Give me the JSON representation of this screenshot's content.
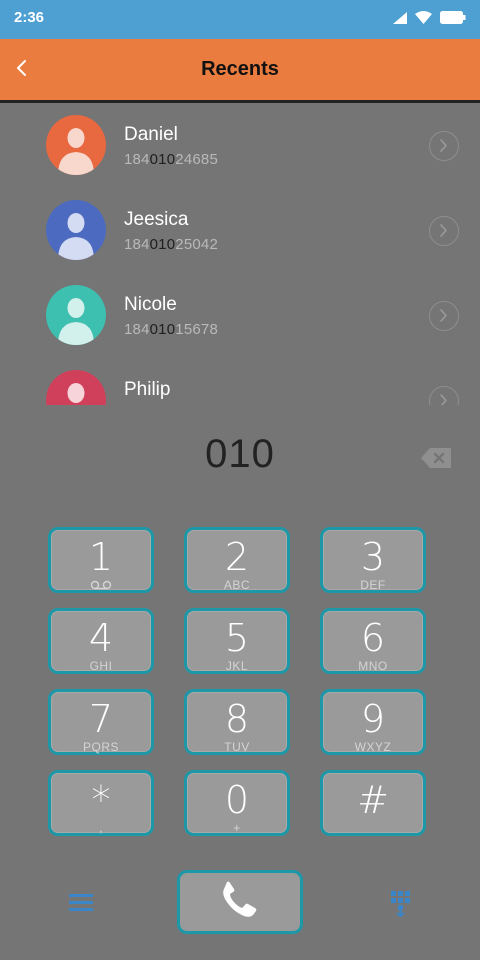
{
  "status_bar": {
    "time": "2:36"
  },
  "header": {
    "title": "Recents"
  },
  "contacts": [
    {
      "name": "Daniel",
      "number_prefix": "184",
      "number_match": "010",
      "number_suffix": "24685",
      "avatar_color": "#e8683f",
      "avatar_light": "#f8d7cc"
    },
    {
      "name": "Jeesica",
      "number_prefix": "184",
      "number_match": "010",
      "number_suffix": "25042",
      "avatar_color": "#4c6bc0",
      "avatar_light": "#d4dcf3"
    },
    {
      "name": "Nicole",
      "number_prefix": "184",
      "number_match": "010",
      "number_suffix": "15678",
      "avatar_color": "#3ec0b0",
      "avatar_light": "#d2f0ec"
    },
    {
      "name": "Philip",
      "number_prefix": "",
      "number_match": "",
      "number_suffix": "",
      "avatar_color": "#d0405a",
      "avatar_light": "#f6d4da"
    }
  ],
  "dialer": {
    "input": "010"
  },
  "keypad": [
    {
      "digit": "1",
      "letters": ""
    },
    {
      "digit": "2",
      "letters": "ABC"
    },
    {
      "digit": "3",
      "letters": "DEF"
    },
    {
      "digit": "4",
      "letters": "GHI"
    },
    {
      "digit": "5",
      "letters": "JKL"
    },
    {
      "digit": "6",
      "letters": "MNO"
    },
    {
      "digit": "7",
      "letters": "PQRS"
    },
    {
      "digit": "8",
      "letters": "TUV"
    },
    {
      "digit": "9",
      "letters": "WXYZ"
    },
    {
      "digit": "*",
      "letters": ","
    },
    {
      "digit": "0",
      "letters": "+"
    },
    {
      "digit": "#",
      "letters": ""
    }
  ],
  "colors": {
    "accent": "#1d98a8",
    "header": "#ea7c3f",
    "status_bar": "#4fa0d2",
    "background": "#757575",
    "icon_blue": "#3a86c8"
  },
  "icons": {
    "back": "chevron-left-icon",
    "delete": "backspace-icon",
    "menu": "menu-icon",
    "call": "phone-icon",
    "dialpad": "dialpad-icon",
    "voicemail": "voicemail-icon"
  }
}
